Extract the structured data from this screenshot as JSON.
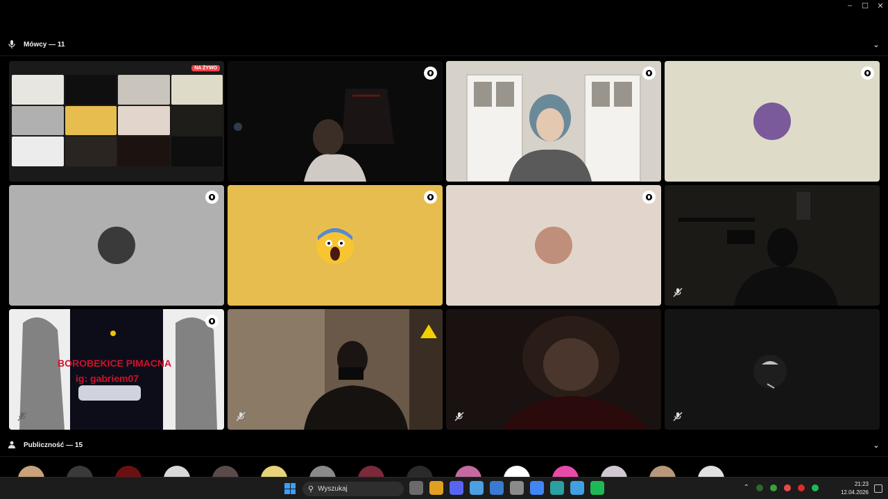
{
  "window": {
    "minimize": "–",
    "maximize": "☐",
    "close": "✕"
  },
  "speakers": {
    "title": "Mówcy — 11"
  },
  "audience": {
    "title": "Publiczność — 15",
    "avatars": [
      "#c9a27a",
      "#3a3a3a",
      "#6b1010",
      "#d8d8d8",
      "#5a4a4a",
      "#e8d27a",
      "#8a8a8a",
      "#7a2a3a",
      "#2a2a2a",
      "#c46aa0",
      "#ffffff",
      "#e84aa8",
      "#d0c8d0",
      "#b89878",
      "#e0e0e0"
    ]
  },
  "tiles": [
    {
      "id": "screen-share",
      "bg": "#1a1a1a",
      "live": "NA ŻYWO"
    },
    {
      "id": "camera-dark-room",
      "bg": "#0c0c0c"
    },
    {
      "id": "camera-teal-hair",
      "bg": "#c9c4bc"
    },
    {
      "id": "avatar-cat",
      "bg": "#dedcc9",
      "avatar": "#7a5a9a"
    },
    {
      "id": "avatar-grey",
      "bg": "#b1b0b0",
      "avatar": "#3a3a3a"
    },
    {
      "id": "avatar-emoji",
      "bg": "#e6bd4e",
      "avatar": "#f7c531"
    },
    {
      "id": "avatar-anime",
      "bg": "#e2d6cc",
      "avatar": "#c08f7c"
    },
    {
      "id": "camera-mask",
      "bg": "#1f1d1a"
    },
    {
      "id": "screen-collage",
      "bg": "#0d0d1a",
      "overlay1": "BOROBEKICE PIMACNA",
      "overlay2": "ig: gabriem07"
    },
    {
      "id": "camera-headphones",
      "bg": "#5a4a3a"
    },
    {
      "id": "camera-blurry",
      "bg": "#1c1310"
    },
    {
      "id": "camera-black",
      "bg": "#141414"
    }
  ],
  "taskbar": {
    "search_placeholder": "Wyszukaj",
    "time": "21:23",
    "date": "12.04.2026",
    "apps": [
      "#6a6a6a",
      "#e0a020",
      "#5865f2",
      "#4aa0e0",
      "#3a7ad0",
      "#8a8a8a",
      "#4285f4",
      "#2aa0a0",
      "#40a0e0",
      "#1db954"
    ],
    "tray_colors": [
      "#2a6a2a",
      "#3aa03a",
      "#e84a4a",
      "#e02a2a",
      "#1db954"
    ]
  }
}
